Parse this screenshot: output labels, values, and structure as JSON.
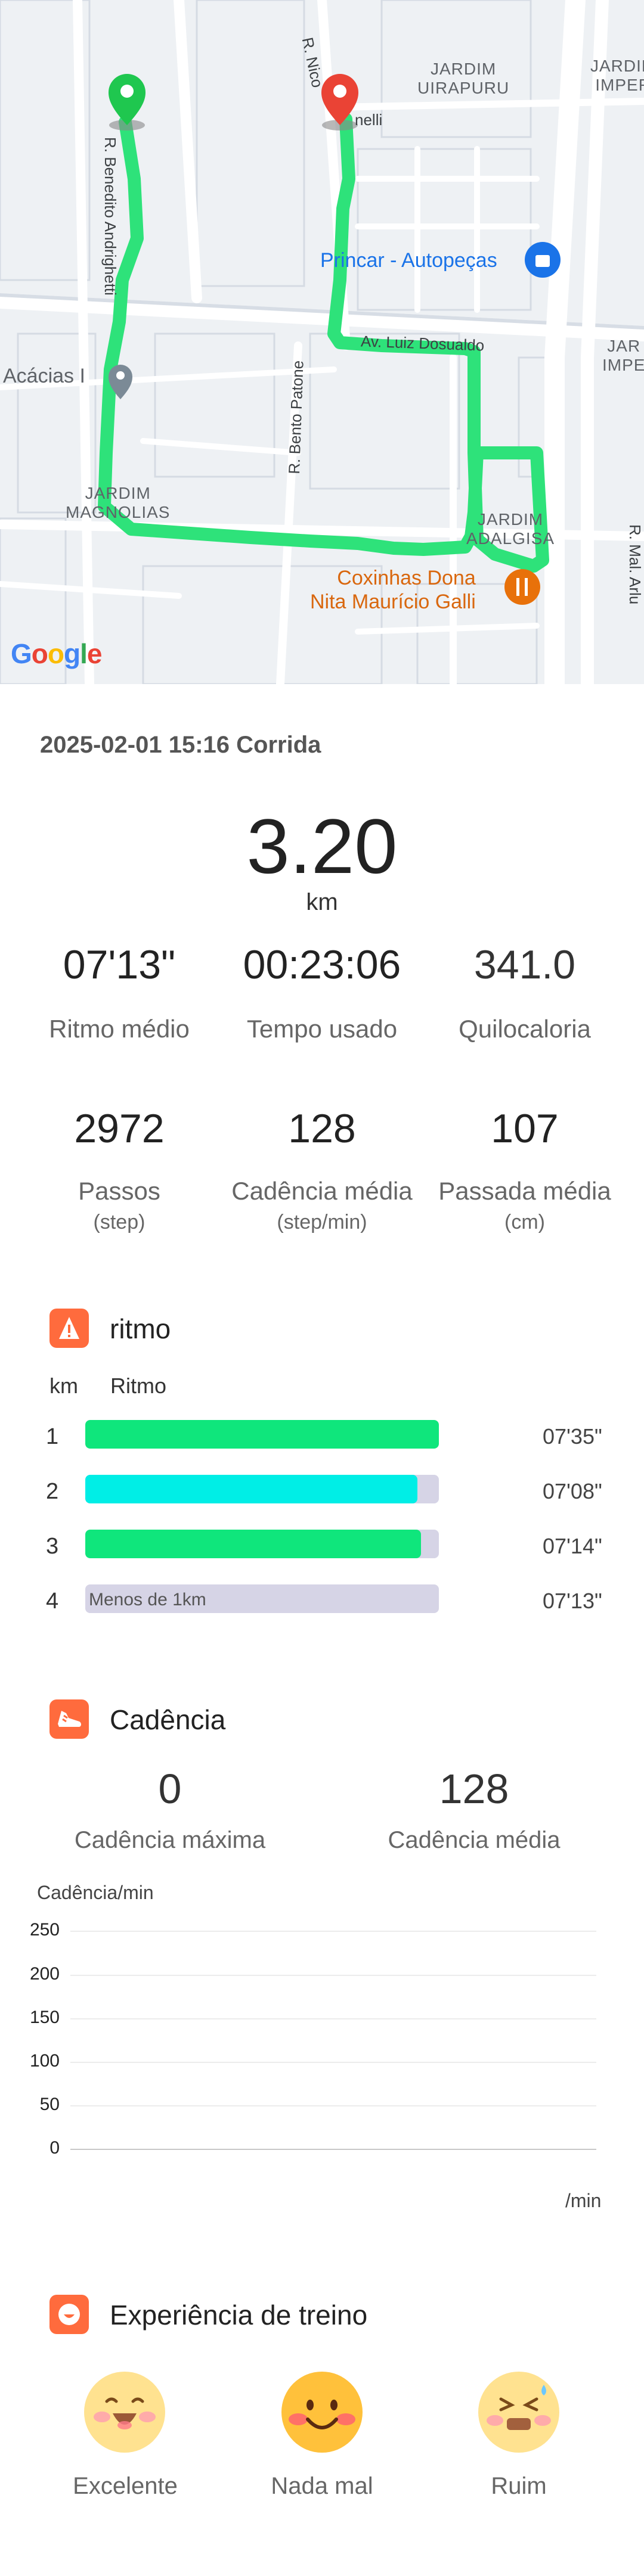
{
  "map": {
    "labels": {
      "jardim_uirapuru": "JARDIM\nUIRAPURU",
      "jardim_imper_top": "JARDIM\nIMPER",
      "jardim_imper_mid": "JAR\nIMPE",
      "acacias": "Acácias I",
      "jardim_magnolias": "JARDIM\nMAGNOLIAS",
      "jardim_adalgisa": "JARDIM\nADALGISA",
      "street_benedito": "R. Benedito Andrighetti",
      "street_nico": "R. Nico",
      "street_nelli": "nelli",
      "street_bento": "R. Bento Patone",
      "street_luiz": "Av. Luiz Dosualdo",
      "street_mal": "R. Mal. Arlu",
      "poi_princar": "Princar - Autopeças",
      "poi_coxinhas": "Coxinhas Dona\nNita Maurício Galli",
      "google": "Google"
    },
    "colors": {
      "route": "#2ee27a",
      "start": "#1fc74f",
      "end": "#ea4335",
      "poi_blue": "#1a73e8",
      "poi_orange": "#e8710a"
    }
  },
  "summary": {
    "datetime": "2025-02-01 15:16",
    "activity": "Corrida",
    "distance": "3.20",
    "distance_unit": "km",
    "stats_row1": [
      {
        "value": "07'13\"",
        "label": "Ritmo médio"
      },
      {
        "value": "00:23:06",
        "label": "Tempo usado"
      },
      {
        "value": "341.0",
        "label": "Quilocaloria"
      }
    ],
    "stats_row2": [
      {
        "value": "2972",
        "label": "Passos",
        "unit": "(step)"
      },
      {
        "value": "128",
        "label": "Cadência média",
        "unit": "(step/min)"
      },
      {
        "value": "107",
        "label": "Passada média",
        "unit": "(cm)"
      }
    ]
  },
  "pace": {
    "title": "ritmo",
    "col_km": "km",
    "col_pace": "Ritmo",
    "rows": [
      {
        "km": "1",
        "pace": "07'35\"",
        "fill": 1.0,
        "color": "#0fe67c"
      },
      {
        "km": "2",
        "pace": "07'08\"",
        "fill": 0.94,
        "color": "#00eee6"
      },
      {
        "km": "3",
        "pace": "07'14\"",
        "fill": 0.95,
        "color": "#0fe67c"
      },
      {
        "km": "4",
        "pace": "07'13\"",
        "fill": 0,
        "color": "#d6d4e6",
        "note": "Menos de 1km"
      }
    ]
  },
  "cadence": {
    "title": "Cadência",
    "max_value": "0",
    "max_label": "Cadência máxima",
    "avg_value": "128",
    "avg_label": "Cadência média",
    "chart_data": {
      "type": "line",
      "ylabel": "Cadência/min",
      "xlabel": "/min",
      "yticks": [
        "250",
        "200",
        "150",
        "100",
        "50",
        "0"
      ],
      "ylim": [
        0,
        250
      ],
      "series": []
    }
  },
  "experience": {
    "title": "Experiência de treino",
    "options": [
      {
        "label": "Excelente",
        "icon": "laughing-face-icon"
      },
      {
        "label": "Nada mal",
        "icon": "smiling-face-icon"
      },
      {
        "label": "Ruim",
        "icon": "tired-face-icon"
      }
    ]
  }
}
